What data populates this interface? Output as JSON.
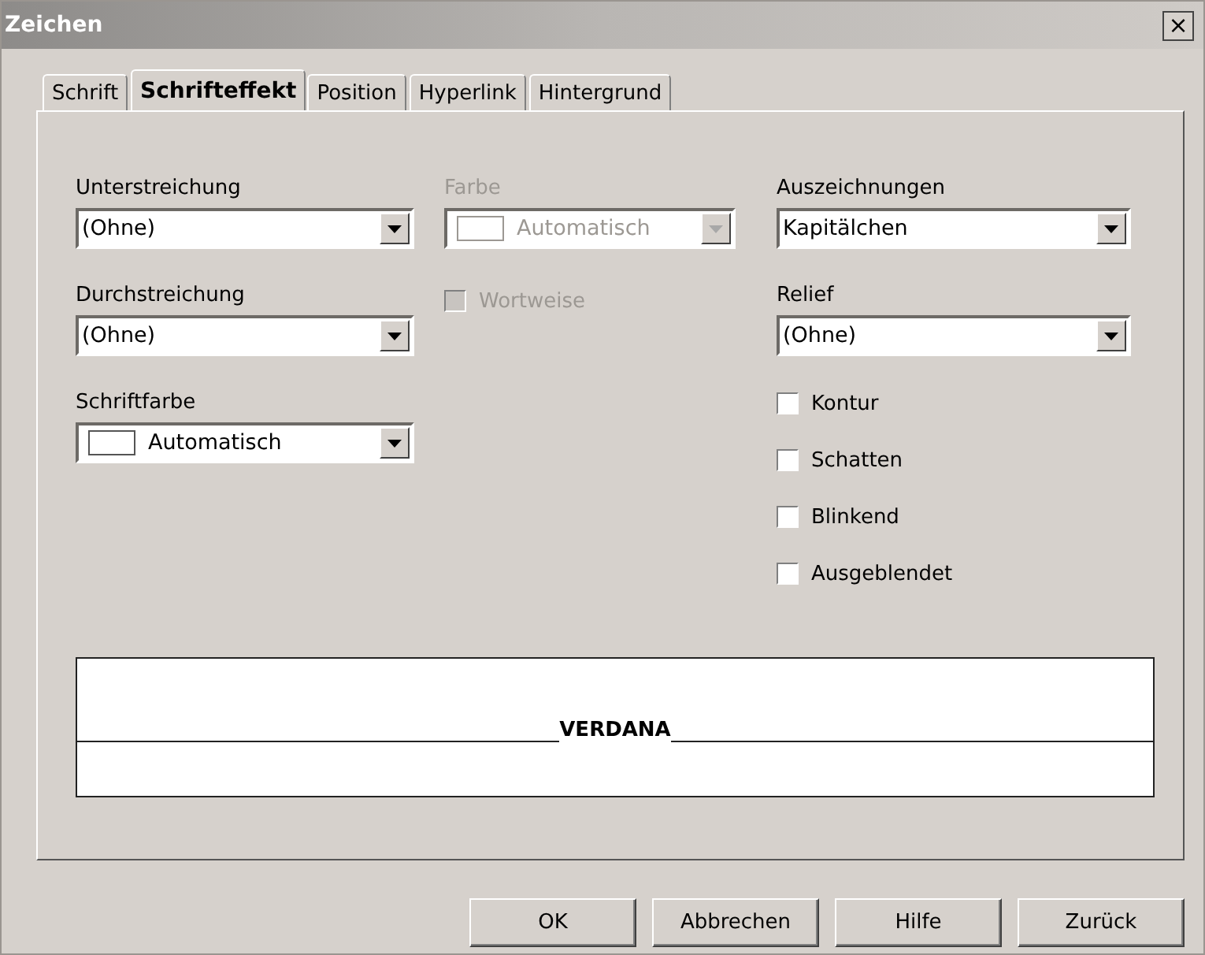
{
  "window": {
    "title": "Zeichen",
    "close": "×"
  },
  "tabs": [
    {
      "label": "Schrift",
      "selected": false
    },
    {
      "label": "Schrifteffekt",
      "selected": true
    },
    {
      "label": "Position",
      "selected": false
    },
    {
      "label": "Hyperlink",
      "selected": false
    },
    {
      "label": "Hintergrund",
      "selected": false
    }
  ],
  "columns": [
    [
      {
        "kind": "dropdown",
        "label": "Unterstreichung",
        "value": "(Ohne)",
        "disabled": false
      },
      {
        "kind": "dropdown",
        "label": "Durchstreichung",
        "value": "(Ohne)",
        "disabled": false
      },
      {
        "kind": "color-dropdown",
        "label": "Schriftfarbe",
        "value": "Automatisch",
        "disabled": false
      }
    ],
    [
      {
        "kind": "color-dropdown",
        "label": "Farbe",
        "value": "Automatisch",
        "disabled": true
      },
      {
        "kind": "checkbox",
        "label": "Wortweise",
        "checked": false,
        "disabled": true
      }
    ],
    [
      {
        "kind": "dropdown",
        "label": "Auszeichnungen",
        "value": "Kapitälchen",
        "disabled": false
      },
      {
        "kind": "dropdown",
        "label": "Relief",
        "value": "(Ohne)",
        "disabled": false
      },
      {
        "kind": "checkbox",
        "label": "Kontur",
        "checked": false,
        "disabled": false
      },
      {
        "kind": "checkbox",
        "label": "Schatten",
        "checked": false,
        "disabled": false
      },
      {
        "kind": "checkbox",
        "label": "Blinkend",
        "checked": false,
        "disabled": false
      },
      {
        "kind": "checkbox",
        "label": "Ausgeblendet",
        "checked": false,
        "disabled": false
      }
    ]
  ],
  "preview": {
    "text": "VERDANA"
  },
  "buttons": [
    {
      "label": "OK"
    },
    {
      "label": "Abbrechen"
    },
    {
      "label": "Hilfe"
    },
    {
      "label": "Zurück"
    }
  ]
}
